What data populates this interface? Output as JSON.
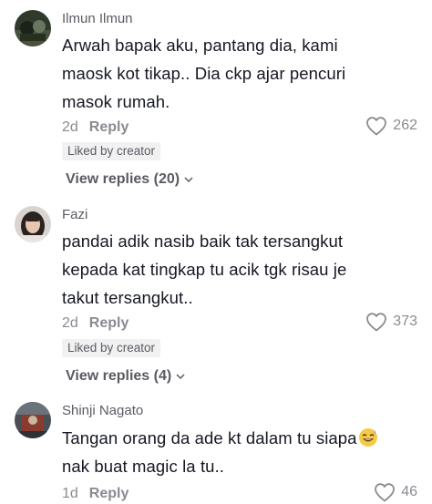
{
  "comments": [
    {
      "username": "Ilmun Ilmun",
      "text": "Arwah bapak aku, pantang dia, kami\nmaosk kot tikap.. Dia ckp ajar pencuri\nmasok rumah.",
      "time": "2d",
      "reply_label": "Reply",
      "likes": "262",
      "badge": "Liked by creator",
      "view_replies": "View replies (20)"
    },
    {
      "username": "Fazi",
      "text": "pandai adik nasib baik tak tersangkut\nkepada kat tingkap tu acik tgk risau je\ntakut tersangkut..",
      "time": "2d",
      "reply_label": "Reply",
      "likes": "373",
      "badge": "Liked by creator",
      "view_replies": "View replies (4)"
    },
    {
      "username": "Shinji Nagato",
      "text_line1": "Tangan orang da ade kt dalam tu siapa",
      "text_line2": "nak buat magic la tu..",
      "time": "1d",
      "reply_label": "Reply",
      "likes": "46"
    }
  ],
  "icons": {
    "heart": "heart-outline-icon",
    "chevron": "chevron-down-icon",
    "emoji": "grinning-sweat-emoji"
  }
}
